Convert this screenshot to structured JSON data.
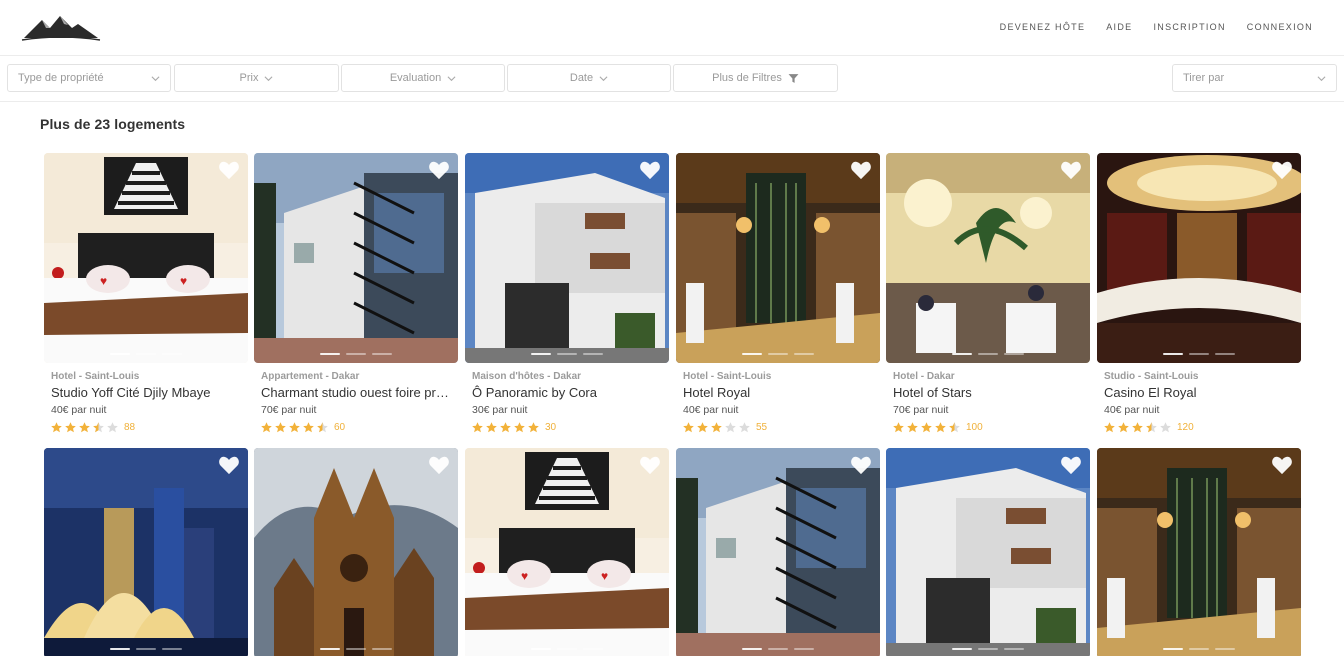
{
  "nav": {
    "host": "DEVENEZ HÔTE",
    "help": "AIDE",
    "signup": "INSCRIPTION",
    "login": "CONNEXION"
  },
  "filters": {
    "type": "Type de propriété",
    "price": "Prix",
    "rating": "Evaluation",
    "date": "Date",
    "more": "Plus de Filtres",
    "sort": "Tirer par"
  },
  "results_count": "Plus de 23 logements",
  "colors": {
    "star": "#f2b23a",
    "star_empty": "#dcdcdc",
    "accent": "#f0b13a"
  },
  "listings": [
    {
      "category": "Hotel - Saint-Louis",
      "title": "Studio Yoff Cité Djily Mbaye",
      "price": "40€ par nuit",
      "rating": 3.5,
      "reviews": "88",
      "photo": "bedroom-zebra"
    },
    {
      "category": "Appartement - Dakar",
      "title": "Charmant studio ouest foire près de l'aéroport",
      "price": "70€ par nuit",
      "rating": 4.5,
      "reviews": "60",
      "photo": "building-staircase"
    },
    {
      "category": "Maison d'hôtes - Dakar",
      "title": "Ô Panoramic by Cora",
      "price": "30€ par nuit",
      "rating": 5,
      "reviews": "30",
      "photo": "white-house"
    },
    {
      "category": "Hotel - Saint-Louis",
      "title": "Hotel Royal",
      "price": "40€ par nuit",
      "rating": 3,
      "reviews": "55",
      "photo": "restaurant"
    },
    {
      "category": "Hotel - Dakar",
      "title": "Hotel of Stars",
      "price": "70€ par nuit",
      "rating": 4.5,
      "reviews": "100",
      "photo": "ballroom"
    },
    {
      "category": "Studio - Saint-Louis",
      "title": "Casino El Royal",
      "price": "40€ par nuit",
      "rating": 3.5,
      "reviews": "120",
      "photo": "bar"
    }
  ],
  "listings_row2": [
    {
      "photo": "opera-house"
    },
    {
      "photo": "cathedral"
    },
    {
      "photo": "bedroom-zebra"
    },
    {
      "photo": "building-staircase"
    },
    {
      "photo": "white-house"
    },
    {
      "photo": "restaurant"
    }
  ]
}
